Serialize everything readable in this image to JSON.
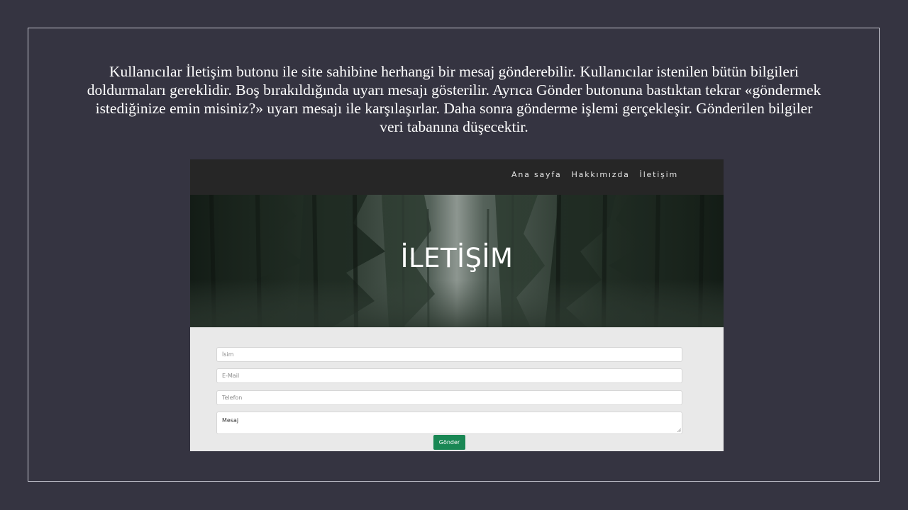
{
  "slide": {
    "description": "Kullanıcılar İletişim butonu ile site sahibine herhangi bir mesaj gönderebilir. Kullanıcılar istenilen bütün bilgileri doldurmaları gereklidir. Boş bırakıldığında uyarı mesajı gösterilir. Ayrıca Gönder butonuna bastıktan tekrar «göndermek istediğinize emin misiniz?»  uyarı mesajı ile karşılaşırlar. Daha sonra gönderme işlemi gerçekleşir. Gönderilen bilgiler veri tabanına düşecektir."
  },
  "site": {
    "nav": {
      "items": [
        {
          "label": "Ana sayfa"
        },
        {
          "label": "Hakkımızda"
        },
        {
          "label": "İletişim"
        }
      ]
    },
    "hero": {
      "title": "İLETİŞİM"
    },
    "form": {
      "name_placeholder": "İsim",
      "email_placeholder": "E-Mail",
      "phone_placeholder": "Telefon",
      "message_placeholder": "Mesaj",
      "submit_label": "Gönder"
    }
  },
  "colors": {
    "slide_background": "#353441",
    "navbar_background": "#262626",
    "form_background": "#e9e9e9",
    "submit_button": "#198754"
  }
}
